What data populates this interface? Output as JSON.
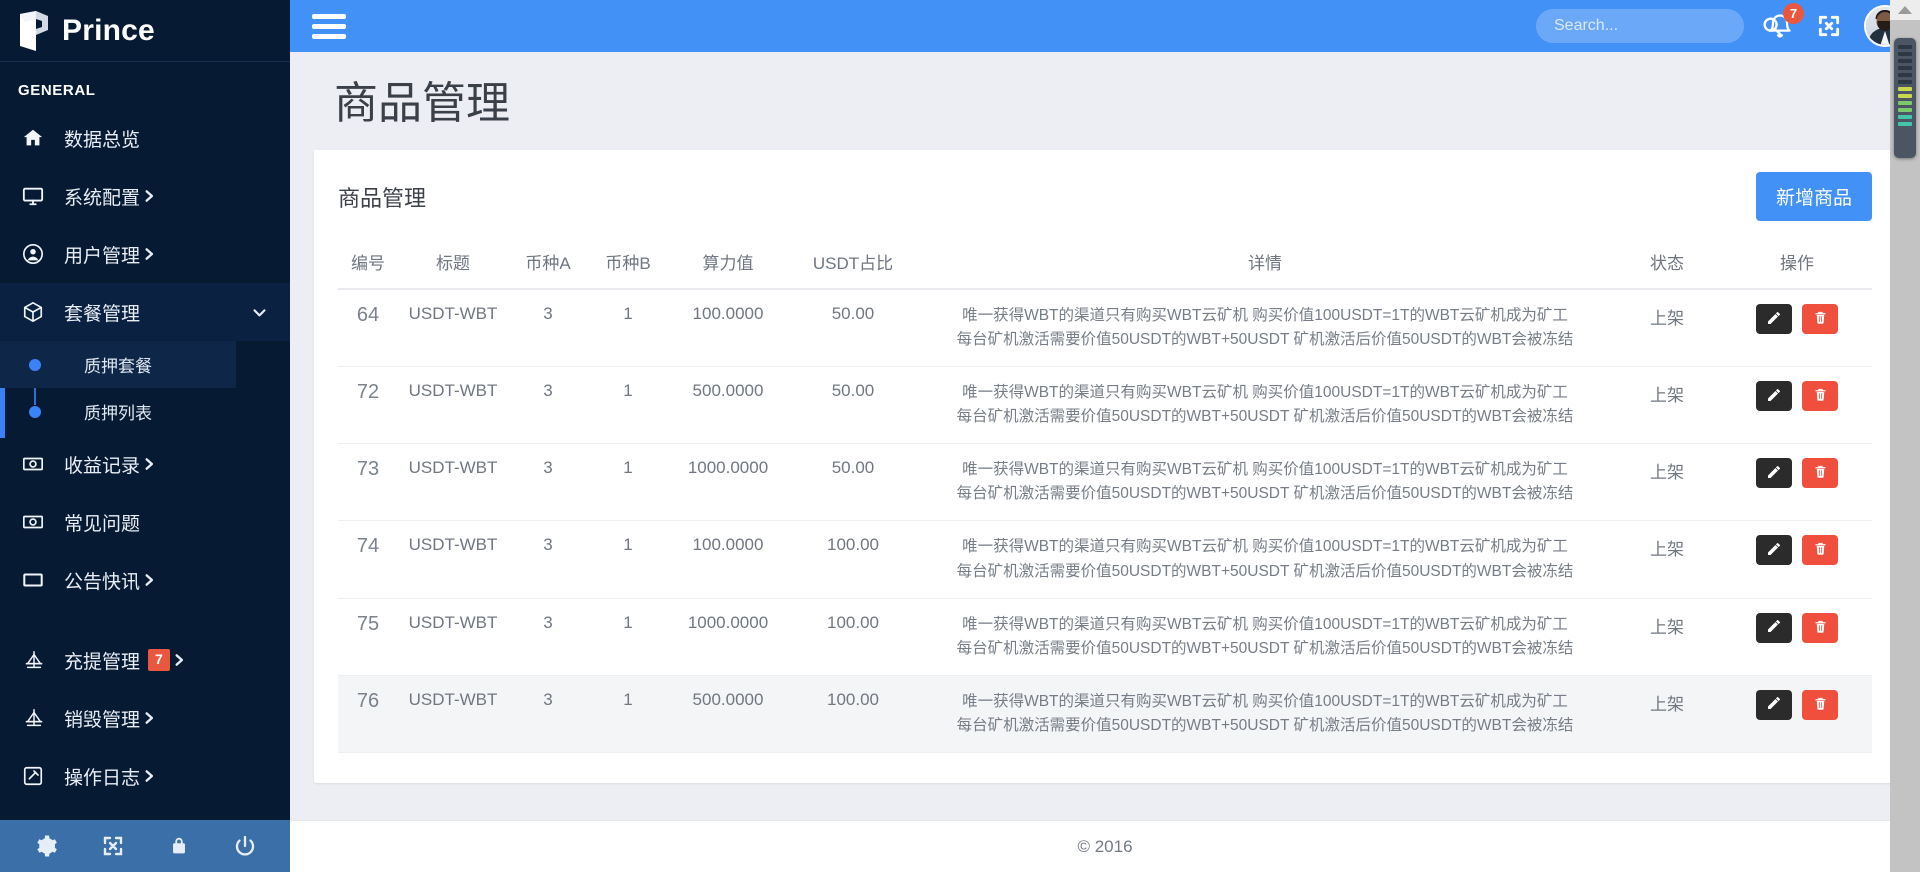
{
  "brand": {
    "name": "Prince",
    "logo_icon": "p-cube-logo-icon"
  },
  "sidebar": {
    "section_label": "GENERAL",
    "items": [
      {
        "label": "数据总览",
        "icon": "home-icon",
        "has_caret": false,
        "badge": null
      },
      {
        "label": "系统配置",
        "icon": "monitor-icon",
        "has_caret": true,
        "badge": null
      },
      {
        "label": "用户管理",
        "icon": "user-circle-icon",
        "has_caret": true,
        "badge": null
      },
      {
        "label": "套餐管理",
        "icon": "box-icon",
        "has_caret": true,
        "badge": null,
        "expanded": true
      },
      {
        "label": "收益记录",
        "icon": "money-icon",
        "has_caret": true,
        "badge": null
      },
      {
        "label": "常见问题",
        "icon": "money-icon",
        "has_caret": false,
        "badge": null
      },
      {
        "label": "公告快讯",
        "icon": "board-icon",
        "has_caret": true,
        "badge": null
      },
      {
        "label": "充提管理",
        "icon": "scale-icon",
        "has_caret": true,
        "badge": "7"
      },
      {
        "label": "销毁管理",
        "icon": "scale-icon",
        "has_caret": true,
        "badge": null
      },
      {
        "label": "操作日志",
        "icon": "edit-square-icon",
        "has_caret": true,
        "badge": null
      }
    ],
    "submenu": [
      {
        "label": "质押套餐",
        "active": true
      },
      {
        "label": "质押列表",
        "active": false
      }
    ],
    "footer_icons": [
      "gear-icon",
      "expand-icon",
      "lock-icon",
      "power-icon"
    ]
  },
  "topbar": {
    "menu_toggle_icon": "hamburger-icon",
    "search": {
      "placeholder": "Search...",
      "value": "",
      "icon": "search-icon"
    },
    "notifications": {
      "icon": "bell-icon",
      "count": "7"
    },
    "fullscreen_icon": "expand-arrows-icon",
    "avatar": "user-avatar"
  },
  "page": {
    "title": "商品管理",
    "card_title": "商品管理",
    "add_button": "新增商品"
  },
  "table": {
    "columns": [
      "编号",
      "标题",
      "币种A",
      "币种B",
      "算力值",
      "USDT占比",
      "详情",
      "状态",
      "操作"
    ],
    "detail_line1": "唯一获得WBT的渠道只有购买WBT云矿机 购买价值100USDT=1T的WBT云矿机成为矿工",
    "detail_line2": "每台矿机激活需要价值50USDT的WBT+50USDT 矿机激活后价值50USDT的WBT会被冻结",
    "actions": {
      "edit_icon": "pencil-icon",
      "delete_icon": "trash-icon"
    },
    "rows": [
      {
        "id": "64",
        "title": "USDT-WBT",
        "coin_a": "3",
        "coin_b": "1",
        "power": "100.0000",
        "usdt_ratio": "50.00",
        "status": "上架",
        "hover": false
      },
      {
        "id": "72",
        "title": "USDT-WBT",
        "coin_a": "3",
        "coin_b": "1",
        "power": "500.0000",
        "usdt_ratio": "50.00",
        "status": "上架",
        "hover": false
      },
      {
        "id": "73",
        "title": "USDT-WBT",
        "coin_a": "3",
        "coin_b": "1",
        "power": "1000.0000",
        "usdt_ratio": "50.00",
        "status": "上架",
        "hover": false
      },
      {
        "id": "74",
        "title": "USDT-WBT",
        "coin_a": "3",
        "coin_b": "1",
        "power": "100.0000",
        "usdt_ratio": "100.00",
        "status": "上架",
        "hover": false
      },
      {
        "id": "75",
        "title": "USDT-WBT",
        "coin_a": "3",
        "coin_b": "1",
        "power": "1000.0000",
        "usdt_ratio": "100.00",
        "status": "上架",
        "hover": false
      },
      {
        "id": "76",
        "title": "USDT-WBT",
        "coin_a": "3",
        "coin_b": "1",
        "power": "500.0000",
        "usdt_ratio": "100.00",
        "status": "上架",
        "hover": true
      }
    ]
  },
  "footer": {
    "copyright": "© 2016"
  },
  "colors": {
    "sidebar_bg": "#071a33",
    "topbar_blue": "#4291f7",
    "accent": "#3b82f6",
    "badge_red": "#e9573f",
    "delete_red": "#f04f3e"
  }
}
